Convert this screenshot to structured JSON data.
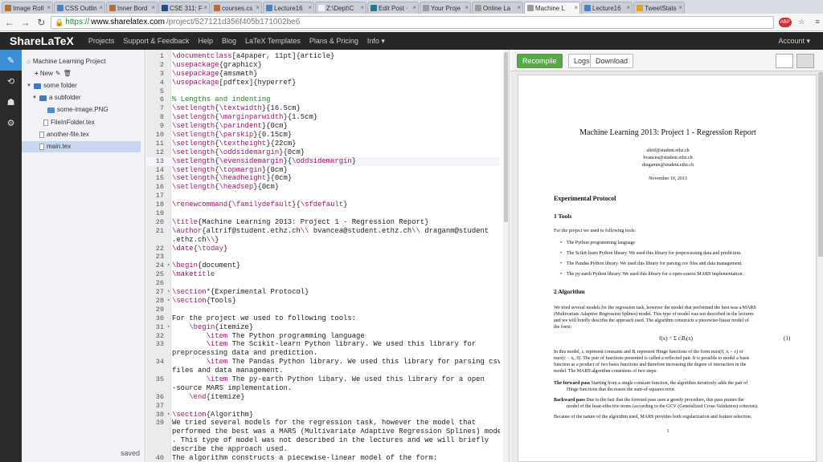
{
  "browser": {
    "tabs": [
      {
        "label": "Image Roll",
        "color": "#b96e2d"
      },
      {
        "label": "CSS Outlin",
        "color": "#4b81c5"
      },
      {
        "label": "Inner Bord",
        "color": "#b96e2d"
      },
      {
        "label": "CSE 311: F",
        "color": "#1d4e89"
      },
      {
        "label": "courses.cs",
        "color": "#b96e2d"
      },
      {
        "label": "Lecture16",
        "color": "#4b81c5"
      },
      {
        "label": "Z:\\Dept\\C",
        "color": "#f2f2f2"
      },
      {
        "label": "Edit Post ·",
        "color": "#21759b"
      },
      {
        "label": "Your Proje",
        "color": "#9b9b9b"
      },
      {
        "label": "Online La",
        "color": "#9b9b9b"
      },
      {
        "label": "Machine L",
        "color": "#9b9b9b"
      },
      {
        "label": "Lecture16",
        "color": "#4b81c5"
      },
      {
        "label": "TweetStats",
        "color": "#e4a11b"
      }
    ],
    "url_https": "https://",
    "url_host": "www.sharelatex.com",
    "url_path": "/project/527121d356f405b171002be6",
    "abp_badge": "ABP"
  },
  "nav": {
    "brand": "ShareLaTeX",
    "links": [
      "Projects",
      "Support & Feedback",
      "Help",
      "Blog",
      "LaTeX Templates",
      "Plans & Pricing",
      "Info ▾"
    ],
    "account": "Account ▾"
  },
  "filetree": {
    "project": "Machine Learning Project",
    "new_label": "New",
    "items": [
      {
        "label": "some folder",
        "type": "folder"
      },
      {
        "label": "a subfolder",
        "type": "folder"
      },
      {
        "label": "some-image.PNG",
        "type": "image"
      },
      {
        "label": "FileInFolder.tex",
        "type": "doc"
      },
      {
        "label": "another-file.tex",
        "type": "doc"
      },
      {
        "label": "main.tex",
        "type": "doc"
      }
    ],
    "saved": "saved"
  },
  "editor": {
    "lines": [
      {
        "n": "1",
        "html": "<span class='k'>\\documentclass</span>[a4paper, 11pt]{article}"
      },
      {
        "n": "2",
        "html": "<span class='k'>\\usepackage</span>{graphicx}"
      },
      {
        "n": "3",
        "html": "<span class='k'>\\usepackage</span>{amsmath}"
      },
      {
        "n": "4",
        "html": "<span class='k'>\\usepackage</span>[pdftex]{hyperref}"
      },
      {
        "n": "5",
        "html": ""
      },
      {
        "n": "6",
        "html": "<span class='c'>% Lengths and indenting</span>"
      },
      {
        "n": "7",
        "html": "<span class='k'>\\setlength</span>{<span class='k'>\\textwidth</span>}{16.5cm}"
      },
      {
        "n": "8",
        "html": "<span class='k'>\\setlength</span>{<span class='k'>\\marginparwidth</span>}{1.5cm}"
      },
      {
        "n": "9",
        "html": "<span class='k'>\\setlength</span>{<span class='k'>\\parindent</span>}{0cm}"
      },
      {
        "n": "10",
        "html": "<span class='k'>\\setlength</span>{<span class='k'>\\parskip</span>}{0.15cm}"
      },
      {
        "n": "11",
        "html": "<span class='k'>\\setlength</span>{<span class='k'>\\textheight</span>}{22cm}"
      },
      {
        "n": "12",
        "html": "<span class='k'>\\setlength</span>{<span class='k'>\\oddsidemargin</span>}{0cm}"
      },
      {
        "n": "13",
        "html": "<span class='k'>\\setlength</span>{<span class='k'>\\evensidemargin</span>}{<span class='k'>\\oddsidemargin</span>}",
        "cur": true
      },
      {
        "n": "14",
        "html": "<span class='k'>\\setlength</span>{<span class='k'>\\topmargin</span>}{0cm}"
      },
      {
        "n": "15",
        "html": "<span class='k'>\\setlength</span>{<span class='k'>\\headheight</span>}{0cm}"
      },
      {
        "n": "16",
        "html": "<span class='k'>\\setlength</span>{<span class='k'>\\headsep</span>}{0cm}"
      },
      {
        "n": "17",
        "html": ""
      },
      {
        "n": "18",
        "html": "<span class='k'>\\renewcommand</span>{<span class='k'>\\familydefault</span>}{<span class='k'>\\sfdefault</span>}"
      },
      {
        "n": "19",
        "html": ""
      },
      {
        "n": "20",
        "html": "<span class='k'>\\title</span>{Machine Learning 2013: Project 1 - Regression Report}"
      },
      {
        "n": "21",
        "html": "<span class='k'>\\author</span>{altrif@student.ethz.ch<span class='k'>\\\\</span> bvancea@student.ethz.ch<span class='k'>\\\\</span> draganm@student"
      },
      {
        "n": "",
        "html": ".ethz.ch<span class='k'>\\\\</span>}"
      },
      {
        "n": "22",
        "html": "<span class='k'>\\date</span>{<span class='k'>\\today</span>}"
      },
      {
        "n": "23",
        "html": ""
      },
      {
        "n": "24",
        "html": "<span class='k'>\\begin</span>{document}",
        "fold": true
      },
      {
        "n": "25",
        "html": "<span class='k'>\\maketitle</span>"
      },
      {
        "n": "26",
        "html": ""
      },
      {
        "n": "27",
        "html": "<span class='k'>\\section</span>*{Experimental Protocol}",
        "fold": true
      },
      {
        "n": "28",
        "html": "<span class='k'>\\section</span>{Tools}",
        "fold": true
      },
      {
        "n": "29",
        "html": ""
      },
      {
        "n": "30",
        "html": "For the project we used to following tools:"
      },
      {
        "n": "31",
        "html": "    <span class='k'>\\begin</span>{itemize}",
        "fold": true
      },
      {
        "n": "32",
        "html": "        <span class='k'>\\item</span> The Python programming language"
      },
      {
        "n": "33",
        "html": "        <span class='k'>\\item</span> The Scikit-learn Python library. We used this library for"
      },
      {
        "n": "",
        "html": "preprocessing data and prediction."
      },
      {
        "n": "34",
        "html": "        <span class='k'>\\item</span> The Pandas Python library. We used this library for parsing csv"
      },
      {
        "n": "",
        "html": "files and data management."
      },
      {
        "n": "35",
        "html": "        <span class='k'>\\item</span> The py-earth Python libary. We used this library for a open"
      },
      {
        "n": "",
        "html": "-source MARS implementation."
      },
      {
        "n": "36",
        "html": "    <span class='k'>\\end</span>{itemize}"
      },
      {
        "n": "37",
        "html": ""
      },
      {
        "n": "38",
        "html": "<span class='k'>\\section</span>{Algorithm}",
        "fold": true
      },
      {
        "n": "39",
        "html": "We tried several models for the regression task, however the model that"
      },
      {
        "n": "",
        "html": "performed the best was a MARS (Multivariate Adaptive Regression Splines) model"
      },
      {
        "n": "",
        "html": ". This type of model was not described in the lectures and we will briefly"
      },
      {
        "n": "",
        "html": "describe the approach used."
      },
      {
        "n": "40",
        "html": "The algorithm constructs a piecewise-linear model of the form:"
      }
    ]
  },
  "preview": {
    "recompile": "Recompile",
    "logs": "Logs",
    "download": "Download",
    "title": "Machine Learning 2013: Project 1 - Regression Report",
    "authors": [
      "altrif@student.ethz.ch",
      "bvancea@student.ethz.ch",
      "dragamm@student.ethz.ch"
    ],
    "date": "November 10, 2013",
    "section_protocol": "Experimental Protocol",
    "section_tools": "1   Tools",
    "tools_intro": "For the project we used to following tools:",
    "bullets": [
      "The Python programming language",
      "The Scikit-learn Python library. We used this library for preprocessing data and prediction.",
      "The Pandas Python library. We used this library for parsing csv files and data management.",
      "The py-earth Python library. We used this library for a open-source MARS implementation."
    ],
    "section_algorithm": "2   Algorithm",
    "algo_para": [
      "We tried several models for the regression task, however the model that performed the best was a MARS",
      "(Multivariate Adaptive Regression Splines) model. This type of model was not described in the lectures",
      "and we will briefly describe the approach used. The algorithm constructs a piecewise-linear model of",
      "the form:"
    ],
    "equation": "f(x) = Σ cᵢBᵢ(x)",
    "equation_number": "(1)",
    "model_para": [
      "In this model, cᵢ represent constants and Bᵢ represent Hinge functions of the form max(0, xᵢ − c) or",
      "max(c − xᵢ, 0). The pair of functions presented is called a reflected pair. It is possible to model a basis",
      "function as a product of two basis functions and therefore increasing the degree of interaction in the",
      "model. The MARS algorithm consistens of two steps:"
    ],
    "forward_label": "The forward pass",
    "forward_text": "Starting from a single constant function, the algorithm iteratively adds the pair of",
    "forward_text2": "Hinge functions that decreases the sum-of-squares error.",
    "backward_label": "Backward pass",
    "backward_text": "Due to the fact that the forward pass uses a greedy procedure, this pass prunes the",
    "backward_text2": "model of the least-effective terms (according to the GCV (Generalized Cross-Validation) criterion).",
    "closing": "Because of the nature of the algorithm used, MARS provides both regularization and feature selection.",
    "page_number": "1"
  }
}
